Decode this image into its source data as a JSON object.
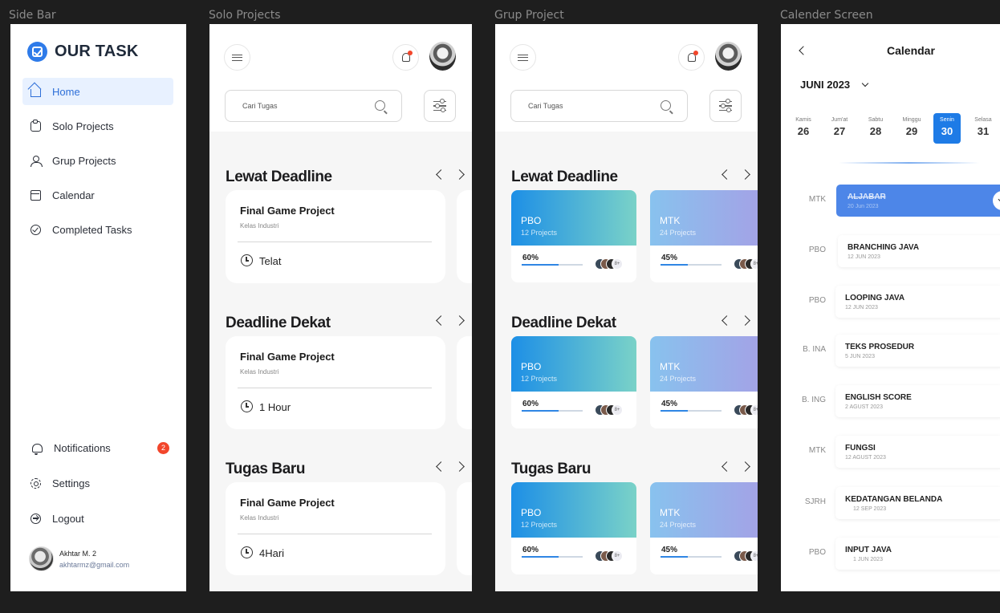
{
  "frames": {
    "sidebar": "Side Bar",
    "solo": "Solo Projects",
    "grup": "Grup Project",
    "calendar": "Calender Screen"
  },
  "sidebar": {
    "brand": "OUR TASK",
    "items": [
      {
        "label": "Home",
        "icon": "home-icon",
        "active": true
      },
      {
        "label": "Solo Projects",
        "icon": "clipboard-icon"
      },
      {
        "label": "Grup Projects",
        "icon": "users-icon"
      },
      {
        "label": "Calendar",
        "icon": "calendar-icon"
      },
      {
        "label": "Completed Tasks",
        "icon": "check-circle-icon"
      }
    ],
    "bottom": [
      {
        "label": "Notifications",
        "icon": "bell-icon",
        "badge": "2"
      },
      {
        "label": "Settings",
        "icon": "gear-icon"
      },
      {
        "label": "Logout",
        "icon": "logout-icon"
      }
    ],
    "user": {
      "name": "Akhtar M. 2",
      "email": "akhtarmz@gmail.com"
    }
  },
  "search": {
    "placeholder": "Cari Tugas"
  },
  "solo": {
    "sections": [
      {
        "title": "Lewat Deadline",
        "card": {
          "title": "Final Game Project",
          "subtitle": "Kelas Industri",
          "status": "Telat"
        }
      },
      {
        "title": "Deadline Dekat",
        "card": {
          "title": "Final Game Project",
          "subtitle": "Kelas Industri",
          "status": "1 Hour"
        }
      },
      {
        "title": "Tugas Baru",
        "card": {
          "title": "Final Game Project",
          "subtitle": "Kelas Industri",
          "status": "4Hari"
        }
      }
    ]
  },
  "grup": {
    "sections": [
      {
        "title": "Lewat Deadline"
      },
      {
        "title": "Deadline Dekat"
      },
      {
        "title": "Tugas Baru"
      }
    ],
    "cards": [
      {
        "name": "PBO",
        "count": "12 Projects",
        "percent": "60%",
        "progress": 0.6,
        "more": "8+"
      },
      {
        "name": "MTK",
        "count": "24 Projects",
        "percent": "45%",
        "progress": 0.45,
        "more": "8+"
      }
    ]
  },
  "calendar": {
    "title": "Calendar",
    "month": "JUNI 2023",
    "days": [
      {
        "name": "Kamis",
        "num": "26"
      },
      {
        "name": "Jum'at",
        "num": "27"
      },
      {
        "name": "Sabtu",
        "num": "28"
      },
      {
        "name": "Minggu",
        "num": "29"
      },
      {
        "name": "Senin",
        "num": "30",
        "active": true
      },
      {
        "name": "Selasa",
        "num": "31"
      }
    ],
    "events": [
      {
        "subject": "MTK",
        "title": "ALJABAR",
        "date": "20 Jun 2023",
        "done": true
      },
      {
        "subject": "PBO",
        "title": "BRANCHING JAVA",
        "date": "12 JUN 2023"
      },
      {
        "subject": "PBO",
        "title": "LOOPING JAVA",
        "date": "12 JUN 2023"
      },
      {
        "subject": "B. INA",
        "title": "TEKS PROSEDUR",
        "date": "5 JUN 2023"
      },
      {
        "subject": "B. ING",
        "title": "ENGLISH SCORE",
        "date": "2 AGUST 2023"
      },
      {
        "subject": "MTK",
        "title": "FUNGSI",
        "date": "12 AGUST 2023"
      },
      {
        "subject": "SJRH",
        "title": "KEDATANGAN BELANDA",
        "date": "12 SEP 2023"
      },
      {
        "subject": "PBO",
        "title": "INPUT JAVA",
        "date": "1 JUN 2023"
      }
    ]
  },
  "colors": {
    "accent": "#2e7be9",
    "badge": "#f2462b",
    "pbo": "#1d8fe6",
    "mtk": "#a79ee5"
  }
}
